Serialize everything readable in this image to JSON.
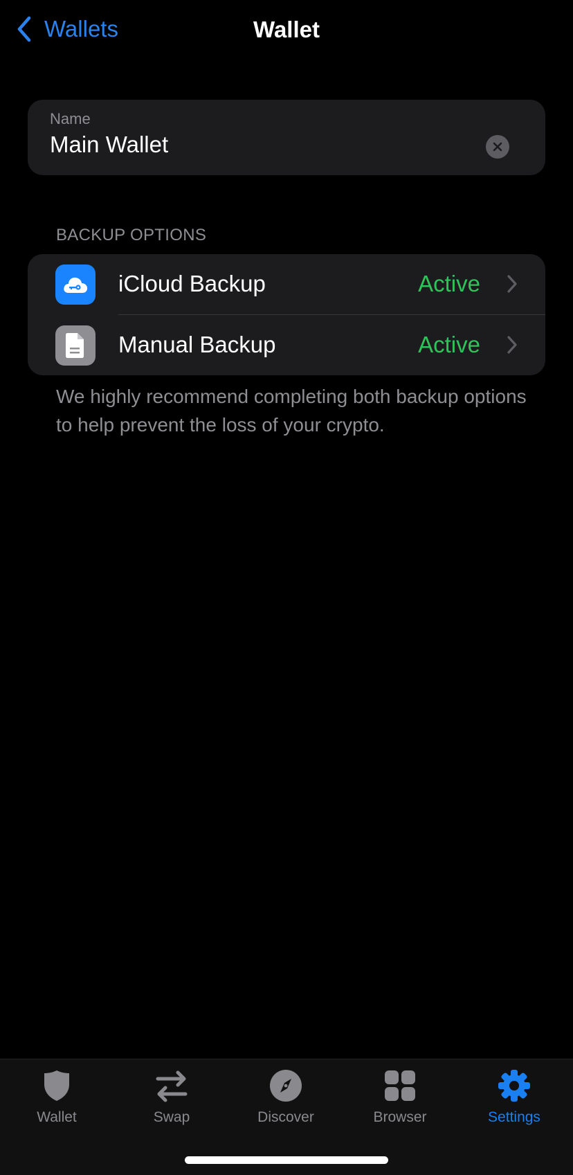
{
  "nav": {
    "back_label": "Wallets",
    "title": "Wallet"
  },
  "name_field": {
    "label": "Name",
    "value": "Main Wallet",
    "clear_icon": "clear-circle-icon"
  },
  "backup": {
    "section_header": "BACKUP OPTIONS",
    "items": [
      {
        "label": "iCloud Backup",
        "status": "Active",
        "icon": "cloud-key-icon",
        "icon_bg": "#1a84ff"
      },
      {
        "label": "Manual Backup",
        "status": "Active",
        "icon": "document-icon",
        "icon_bg": "#8e8e93"
      }
    ],
    "footnote": "We highly recommend completing both backup options to help prevent the loss of your crypto."
  },
  "tabbar": {
    "tabs": [
      {
        "label": "Wallet",
        "icon": "shield-icon",
        "active": false
      },
      {
        "label": "Swap",
        "icon": "swap-arrows-icon",
        "active": false
      },
      {
        "label": "Discover",
        "icon": "compass-icon",
        "active": false
      },
      {
        "label": "Browser",
        "icon": "grid-icon",
        "active": false
      },
      {
        "label": "Settings",
        "icon": "gear-icon",
        "active": true
      }
    ]
  },
  "colors": {
    "accent": "#2a82ec",
    "status_active": "#30c35a",
    "tab_active": "#1a7ff0",
    "tab_inactive": "#8a8a8e",
    "card_bg": "#1c1c1e"
  }
}
